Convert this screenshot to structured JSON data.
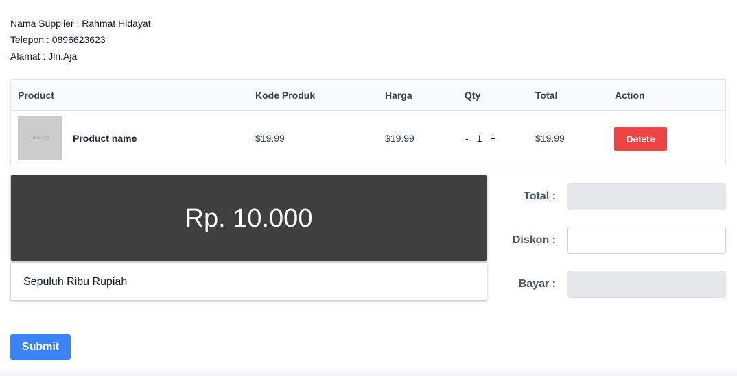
{
  "supplier": {
    "name_line": "Nama Supplier : Rahmat Hidayat",
    "phone_line": "Telepon : 0896623623",
    "address_line": "Alamat : Jln.Aja"
  },
  "table": {
    "headers": [
      "Product",
      "Kode Produk",
      "Harga",
      "Qty",
      "Total",
      "Action"
    ],
    "rows": [
      {
        "thumbnail_text": "100 x 100",
        "product_name": "Product name",
        "kode_produk": "$19.99",
        "harga": "$19.99",
        "qty_minus": "-",
        "qty": "1",
        "qty_plus": "+",
        "total": "$19.99",
        "action_label": "Delete"
      }
    ]
  },
  "summary": {
    "amount": "Rp. 10.000",
    "amount_words": "Sepuluh Ribu Rupiah"
  },
  "form": {
    "total_label": "Total :",
    "total_value": "",
    "diskon_label": "Diskon :",
    "diskon_value": "",
    "bayar_label": "Bayar :",
    "bayar_value": ""
  },
  "submit_label": "Submit",
  "colors": {
    "delete": "#ef4444",
    "submit": "#3b82f6",
    "amount_bg": "#404040"
  }
}
